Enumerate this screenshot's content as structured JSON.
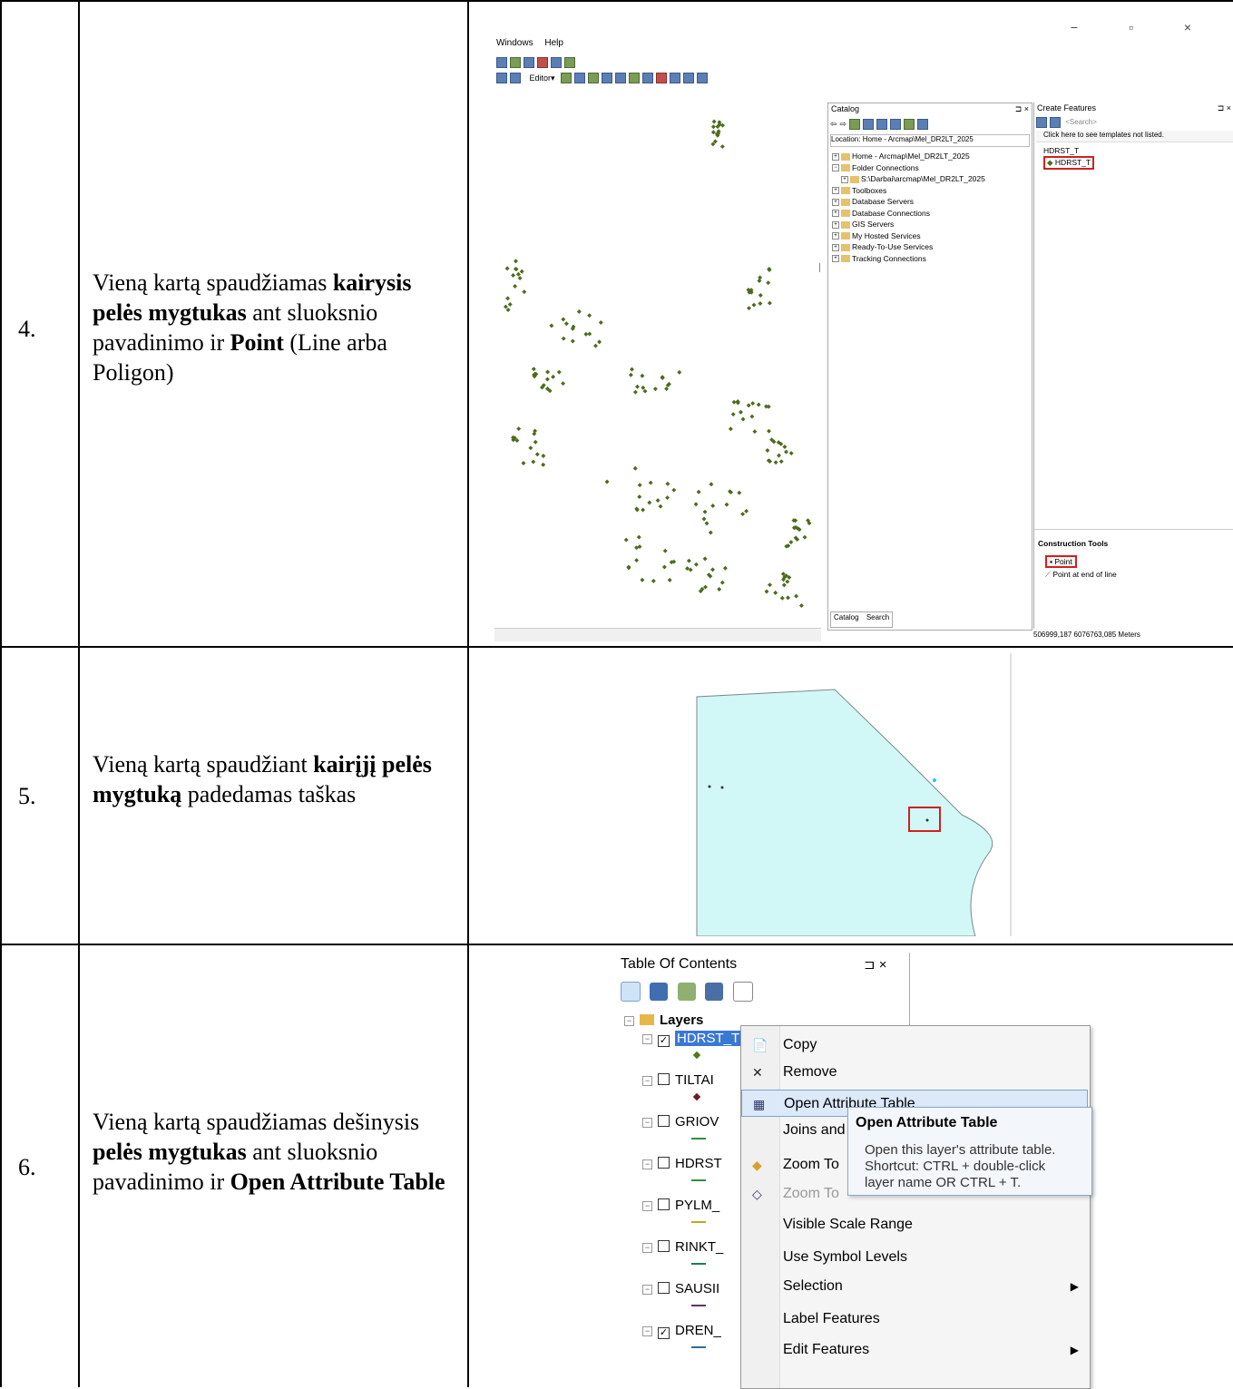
{
  "rows": [
    {
      "num": "4.",
      "desc_parts": [
        "Vieną kartą spaudžiamas ",
        "kairysis pelės mygtukas",
        " ant sluoksnio pavadinimo ir ",
        "Point",
        " (Line arba Poligon)"
      ]
    },
    {
      "num": "5.",
      "desc_parts": [
        "Vieną kartą spaudžiant ",
        "kairįjį pelės mygtuką",
        " padedamas taškas"
      ]
    },
    {
      "num": "6.",
      "desc_parts": [
        "Vieną kartą spaudžiamas dešinysis ",
        "pelės mygtukas",
        " ant sluoksnio pavadinimo ir ",
        "Open Attribute Table"
      ]
    }
  ],
  "arcmap": {
    "window_controls": "−   ▫   ×",
    "menu": [
      "Windows",
      "Help"
    ],
    "editor_label": "Editor▾",
    "catalog": {
      "title": "Catalog",
      "location_label": "Location:",
      "location_value": "Home - Arcmap\\Mel_DR2LT_2025",
      "tree": [
        {
          "label": "Home - Arcmap\\Mel_DR2LT_2025",
          "indent": 0
        },
        {
          "label": "Folder Connections",
          "indent": 0
        },
        {
          "label": "S:\\Darbai\\arcmap\\Mel_DR2LT_2025",
          "indent": 1
        },
        {
          "label": "Toolboxes",
          "indent": 0
        },
        {
          "label": "Database Servers",
          "indent": 0
        },
        {
          "label": "Database Connections",
          "indent": 0
        },
        {
          "label": "GIS Servers",
          "indent": 0
        },
        {
          "label": "My Hosted Services",
          "indent": 0
        },
        {
          "label": "Ready-To-Use Services",
          "indent": 0
        },
        {
          "label": "Tracking Connections",
          "indent": 0
        }
      ],
      "tab_catalog": "Catalog",
      "tab_search": "Search"
    },
    "create_features": {
      "title": "Create Features",
      "search_placeholder": "<Search>",
      "notice": "Click here to see templates not listed.",
      "template_group": "HDRST_T",
      "template_item": "HDRST_T",
      "construction_title": "Construction Tools",
      "tool_point": "Point",
      "tool_point_end": "Point at end of line"
    },
    "status_coords": "506999,187  6076763,085 Meters"
  },
  "toc": {
    "title": "Table Of Contents",
    "root": "Layers",
    "layers": [
      {
        "name": "HDRST_T",
        "checked": true,
        "color": "#4d7a1d"
      },
      {
        "name": "TILTAI",
        "checked": false,
        "color": "#6b1a2a"
      },
      {
        "name": "GRIOV",
        "checked": false,
        "color": "#2f8f3f"
      },
      {
        "name": "HDRST",
        "checked": false,
        "color": "#2f8f3f"
      },
      {
        "name": "PYLM_",
        "checked": false,
        "color": "#c6a51b"
      },
      {
        "name": "RINKT_",
        "checked": false,
        "color": "#1a7a5a"
      },
      {
        "name": "SAUSII",
        "checked": false,
        "color": "#6b2b6b"
      },
      {
        "name": "DREN_",
        "checked": true,
        "color": "#2f6f8f"
      }
    ],
    "menu": [
      {
        "label": "Copy",
        "icon": "copy-icon",
        "arrow": false,
        "highlight": false,
        "disabled": false
      },
      {
        "label": "Remove",
        "icon": "remove-icon",
        "arrow": false,
        "highlight": false,
        "disabled": false
      },
      {
        "label": "Open Attribute Table",
        "icon": "table-icon",
        "arrow": false,
        "highlight": true,
        "disabled": false
      },
      {
        "label": "Joins and Relates",
        "icon": "",
        "arrow": true,
        "highlight": false,
        "disabled": false
      },
      {
        "label": "Zoom To",
        "icon": "zoom-to-icon",
        "arrow": false,
        "highlight": false,
        "disabled": false
      },
      {
        "label": "Zoom To",
        "icon": "zoom-to-dim-icon",
        "arrow": false,
        "highlight": false,
        "disabled": true
      },
      {
        "label": "Visible Scale Range",
        "icon": "",
        "arrow": false,
        "highlight": false,
        "disabled": false
      },
      {
        "label": "Use Symbol Levels",
        "icon": "",
        "arrow": false,
        "highlight": false,
        "disabled": false
      },
      {
        "label": "Selection",
        "icon": "",
        "arrow": true,
        "highlight": false,
        "disabled": false
      },
      {
        "label": "Label Features",
        "icon": "",
        "arrow": false,
        "highlight": false,
        "disabled": false
      },
      {
        "label": "Edit Features",
        "icon": "",
        "arrow": true,
        "highlight": false,
        "disabled": false
      }
    ],
    "tooltip": {
      "title": "Open Attribute Table",
      "body": [
        "Open this layer's attribute table.",
        "Shortcut: CTRL + double-click",
        "layer name OR CTRL + T."
      ]
    }
  },
  "colors": {
    "polygon_fill": "#d2f7f7",
    "point_green": "#4d6b1d",
    "highlight_red": "#d21f1f"
  }
}
